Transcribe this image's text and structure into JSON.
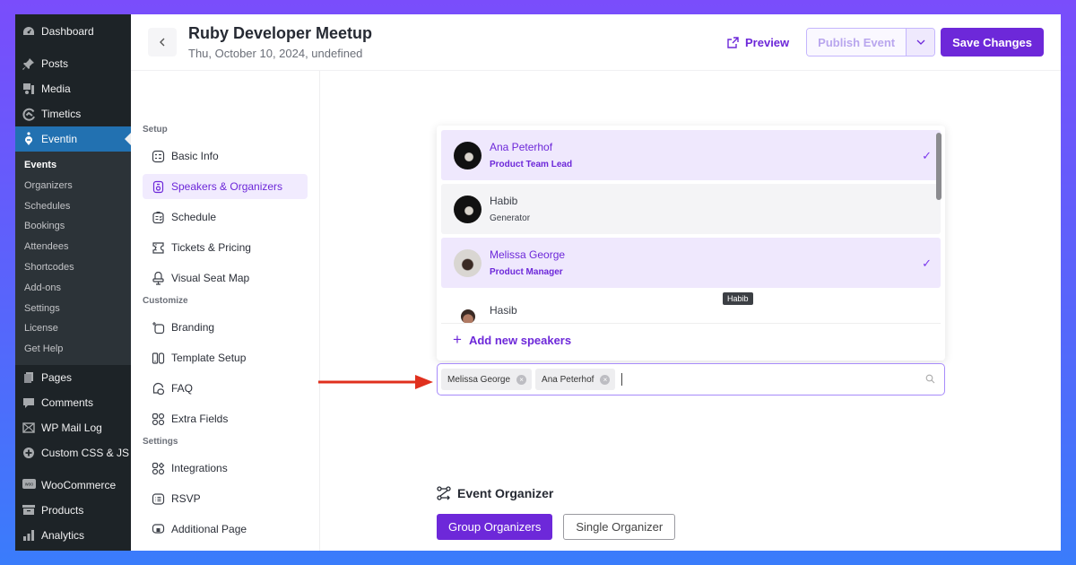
{
  "wp_sidebar": {
    "items_top": [
      {
        "label": "Dashboard",
        "icon": "dashboard-icon"
      },
      {
        "label": "Posts",
        "icon": "pin-icon"
      },
      {
        "label": "Media",
        "icon": "media-icon"
      },
      {
        "label": "Timetics",
        "icon": "timetics-icon"
      },
      {
        "label": "Eventin",
        "icon": "eventin-icon",
        "active": true
      }
    ],
    "submenu": [
      "Events",
      "Organizers",
      "Schedules",
      "Bookings",
      "Attendees",
      "Shortcodes",
      "Add-ons",
      "Settings",
      "License",
      "Get Help"
    ],
    "submenu_current": "Events",
    "items_bottom": [
      {
        "label": "Pages",
        "icon": "pages-icon"
      },
      {
        "label": "Comments",
        "icon": "comments-icon"
      },
      {
        "label": "WP Mail Log",
        "icon": "mail-icon"
      },
      {
        "label": "Custom CSS & JS",
        "icon": "plus-circle-icon"
      },
      {
        "label": "WooCommerce",
        "icon": "woo-icon"
      },
      {
        "label": "Products",
        "icon": "archive-icon"
      },
      {
        "label": "Analytics",
        "icon": "bar-chart-icon"
      }
    ]
  },
  "header": {
    "back_icon": "chevron-left-icon",
    "title": "Ruby Developer Meetup",
    "subtitle": "Thu, October 10, 2024, undefined",
    "preview_label": "Preview",
    "publish_label": "Publish Event",
    "save_label": "Save Changes"
  },
  "settings_nav": {
    "sections": [
      {
        "title": "Setup",
        "items": [
          {
            "label": "Basic Info",
            "icon": "form-icon"
          },
          {
            "label": "Speakers & Organizers",
            "icon": "speaker-icon",
            "active": true
          },
          {
            "label": "Schedule",
            "icon": "clipboard-icon"
          },
          {
            "label": "Tickets & Pricing",
            "icon": "ticket-icon"
          },
          {
            "label": "Visual Seat Map",
            "icon": "seat-icon"
          }
        ]
      },
      {
        "title": "Customize",
        "items": [
          {
            "label": "Branding",
            "icon": "branding-icon"
          },
          {
            "label": "Template Setup",
            "icon": "template-icon"
          },
          {
            "label": "FAQ",
            "icon": "chat-icon"
          },
          {
            "label": "Extra Fields",
            "icon": "grid-icon"
          }
        ]
      },
      {
        "title": "Settings",
        "items": [
          {
            "label": "Integrations",
            "icon": "integrations-icon"
          },
          {
            "label": "RSVP",
            "icon": "list-icon"
          },
          {
            "label": "Additional Page",
            "icon": "page-icon"
          }
        ]
      }
    ]
  },
  "speakers_dropdown": {
    "options": [
      {
        "name": "Ana Peterhof",
        "role": "Product Team Lead",
        "selected": true
      },
      {
        "name": "Habib",
        "role": "Generator",
        "selected": false,
        "hovered": true
      },
      {
        "name": "Melissa George",
        "role": "Product Manager",
        "selected": true
      },
      {
        "name": "Hasib",
        "role": "",
        "selected": false
      }
    ],
    "tooltip": "Habib",
    "add_new_label": "Add new speakers"
  },
  "speakers_select": {
    "tags": [
      "Melissa George",
      "Ana Peterhof"
    ],
    "value": ""
  },
  "organizer": {
    "title": "Event Organizer",
    "group_label": "Group Organizers",
    "single_label": "Single Organizer"
  },
  "colors": {
    "accent": "#6d28d9",
    "selected_bg": "#efe8fd",
    "wp_sidebar": "#1d2327",
    "wp_active": "#2271b1",
    "arrow": "#e0301e"
  }
}
